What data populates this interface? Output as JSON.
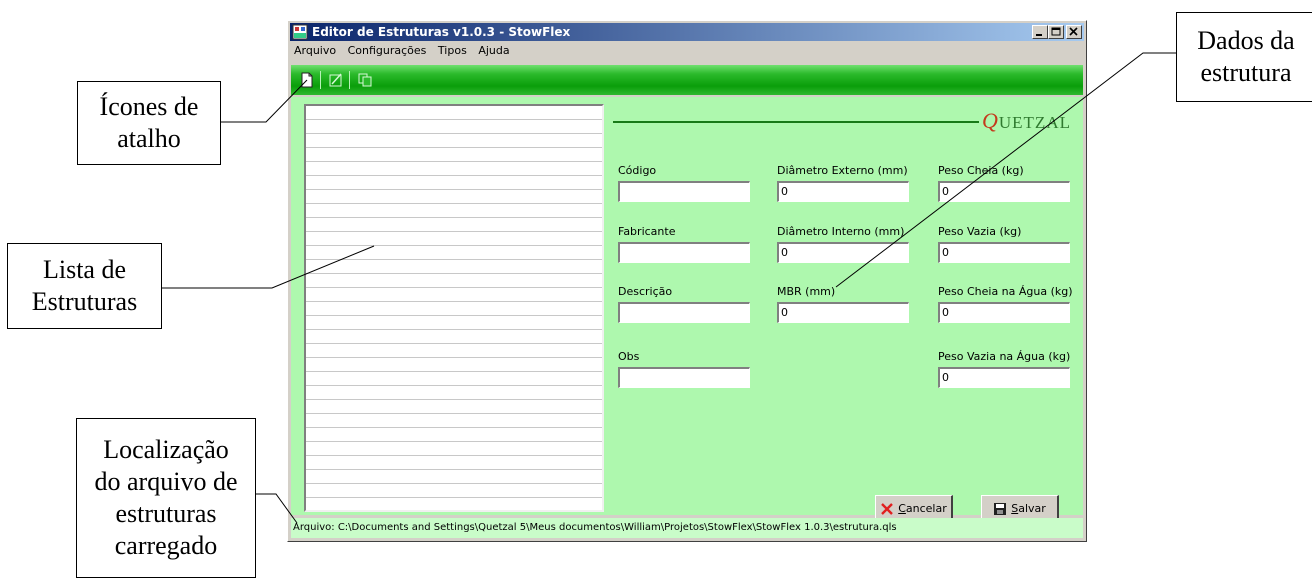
{
  "window": {
    "title": "Editor de Estruturas v1.0.3 - StowFlex",
    "menu": [
      "Arquivo",
      "Configurações",
      "Tipos",
      "Ajuda"
    ]
  },
  "toolbar": {
    "icons": [
      "new-file-icon",
      "edit-icon",
      "copy-icon"
    ]
  },
  "logo": {
    "first": "Q",
    "rest": "UETZAL"
  },
  "form": {
    "codigo": {
      "label": "Código",
      "value": ""
    },
    "fabricante": {
      "label": "Fabricante",
      "value": ""
    },
    "descricao": {
      "label": "Descrição",
      "value": ""
    },
    "obs": {
      "label": "Obs",
      "value": ""
    },
    "diam_ext": {
      "label": "Diâmetro Externo (mm)",
      "value": "0"
    },
    "diam_int": {
      "label": "Diâmetro Interno (mm)",
      "value": "0"
    },
    "mbr": {
      "label": "MBR (mm)",
      "value": "0"
    },
    "peso_cheia": {
      "label": "Peso Cheia (kg)",
      "value": "0"
    },
    "peso_vazia": {
      "label": "Peso Vazia (kg)",
      "value": "0"
    },
    "peso_cheia_agua": {
      "label": "Peso Cheia na Água (kg)",
      "value": "0"
    },
    "peso_vazia_agua": {
      "label": "Peso Vazia na Água (kg)",
      "value": "0"
    }
  },
  "buttons": {
    "cancel": {
      "mnemonic": "C",
      "rest": "ancelar"
    },
    "save": {
      "mnemonic": "S",
      "rest": "alvar"
    }
  },
  "status": "Arquivo: C:\\Documents and Settings\\Quetzal 5\\Meus documentos\\William\\Projetos\\StowFlex\\StowFlex 1.0.3\\estrutura.qls",
  "callouts": {
    "icones": [
      "Ícones de",
      "atalho"
    ],
    "lista": [
      "Lista de",
      "Estruturas"
    ],
    "local": [
      "Localização",
      "do arquivo de",
      "estruturas",
      "carregado"
    ],
    "dados": [
      "Dados da",
      "estrutura"
    ]
  }
}
